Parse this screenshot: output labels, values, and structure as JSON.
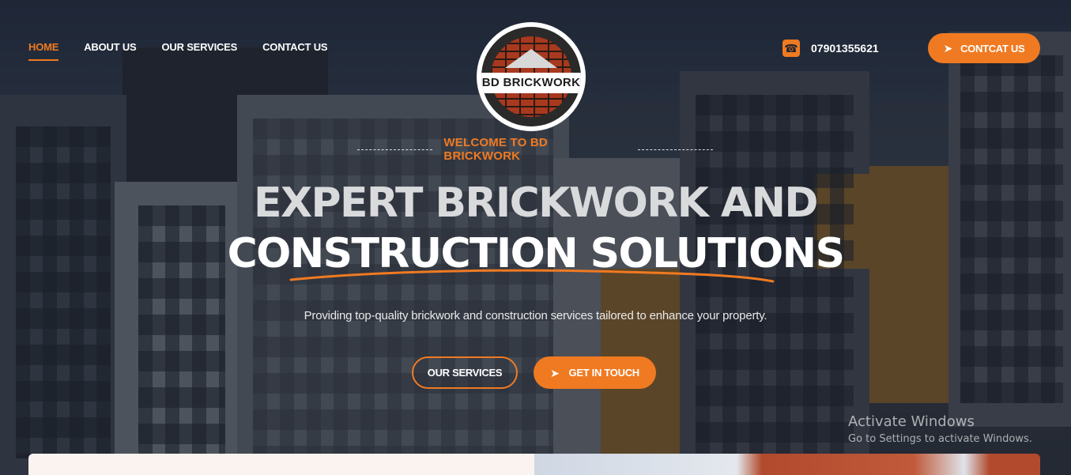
{
  "nav": {
    "items": [
      {
        "label": "HOME",
        "active": true
      },
      {
        "label": "ABOUT US",
        "active": false
      },
      {
        "label": "OUR SERVICES",
        "active": false
      },
      {
        "label": "CONTACT US",
        "active": false
      }
    ]
  },
  "logo": {
    "text": "BD BRICKWORK"
  },
  "header": {
    "phone_icon": "phone-icon",
    "phone": "07901355621",
    "contact_button": "CONTCAT US",
    "contact_icon": "paper-plane-icon"
  },
  "hero": {
    "welcome": "WELCOME TO BD BRICKWORK",
    "headline_line1": "EXPERT BRICKWORK AND",
    "headline_line2": "CONSTRUCTION SOLUTIONS",
    "subtitle": "Providing top-quality brickwork and construction services tailored to enhance your property.",
    "buttons": {
      "services": "OUR SERVICES",
      "touch": "GET IN TOUCH",
      "touch_icon": "paper-plane-icon"
    }
  },
  "watermark": {
    "title": "Activate Windows",
    "subtitle": "Go to Settings to activate Windows."
  },
  "colors": {
    "accent": "#f07a21",
    "overlay": "#161b26"
  }
}
